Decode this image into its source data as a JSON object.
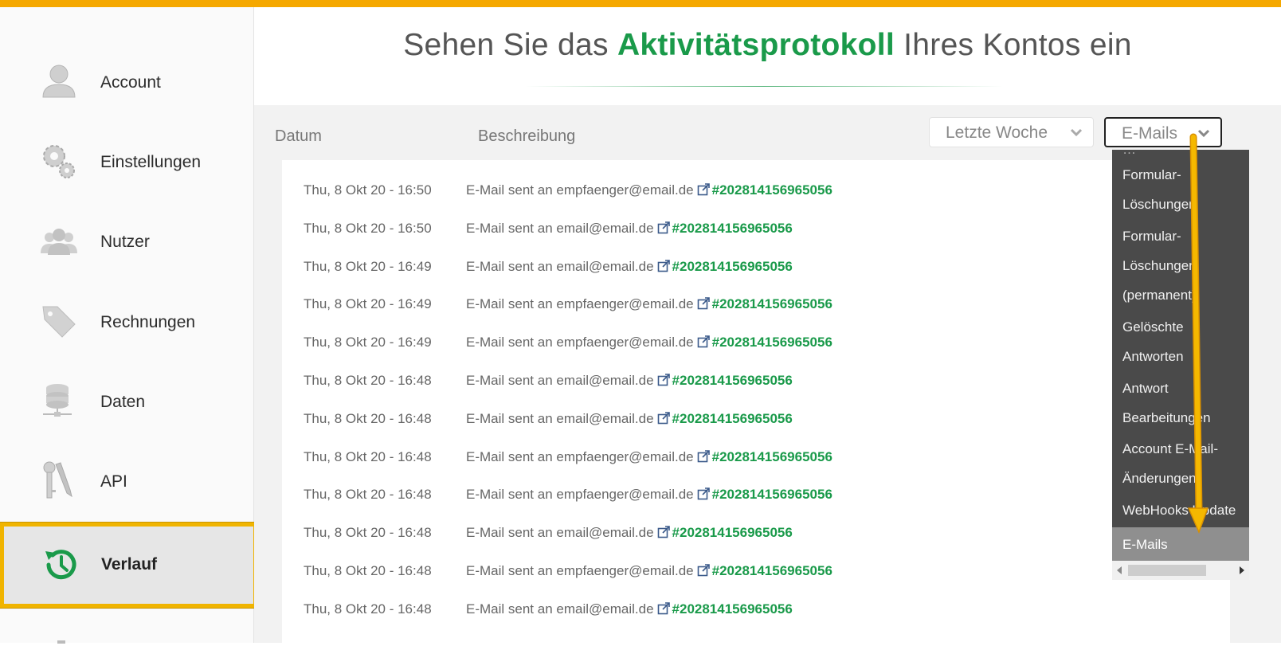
{
  "header": {
    "title_part1": "Sehen Sie das ",
    "title_highlight": "Aktivitätsprotokoll",
    "title_part2": " Ihres Kontos ein"
  },
  "sidebar": {
    "items": [
      {
        "label": "Account",
        "icon": "user-icon"
      },
      {
        "label": "Einstellungen",
        "icon": "gears-icon"
      },
      {
        "label": "Nutzer",
        "icon": "users-icon"
      },
      {
        "label": "Rechnungen",
        "icon": "tag-icon"
      },
      {
        "label": "Daten",
        "icon": "database-icon"
      },
      {
        "label": "API",
        "icon": "keys-icon"
      },
      {
        "label": "Verlauf",
        "icon": "history-icon",
        "active": true
      }
    ]
  },
  "table": {
    "col_date": "Datum",
    "col_desc": "Beschreibung",
    "filter_time": "Letzte Woche",
    "filter_type": "E-Mails",
    "rows": [
      {
        "date": "Thu, 8 Okt 20 - 16:50",
        "text": "E-Mail sent an empfaenger@email.de",
        "link": "#202814156965056"
      },
      {
        "date": "Thu, 8 Okt 20 - 16:50",
        "text": "E-Mail sent an email@email.de",
        "link": "#202814156965056"
      },
      {
        "date": "Thu, 8 Okt 20 - 16:49",
        "text": "E-Mail sent an email@email.de",
        "link": "#202814156965056"
      },
      {
        "date": "Thu, 8 Okt 20 - 16:49",
        "text": "E-Mail sent an empfaenger@email.de",
        "link": "#202814156965056"
      },
      {
        "date": "Thu, 8 Okt 20 - 16:49",
        "text": "E-Mail sent an empfaenger@email.de",
        "link": "#202814156965056"
      },
      {
        "date": "Thu, 8 Okt 20 - 16:48",
        "text": "E-Mail sent an email@email.de",
        "link": "#202814156965056"
      },
      {
        "date": "Thu, 8 Okt 20 - 16:48",
        "text": "E-Mail sent an email@email.de",
        "link": "#202814156965056"
      },
      {
        "date": "Thu, 8 Okt 20 - 16:48",
        "text": "E-Mail sent an empfaenger@email.de",
        "link": "#202814156965056"
      },
      {
        "date": "Thu, 8 Okt 20 - 16:48",
        "text": "E-Mail sent an empfaenger@email.de",
        "link": "#202814156965056"
      },
      {
        "date": "Thu, 8 Okt 20 - 16:48",
        "text": "E-Mail sent an email@email.de",
        "link": "#202814156965056"
      },
      {
        "date": "Thu, 8 Okt 20 - 16:48",
        "text": "E-Mail sent an empfaenger@email.de",
        "link": "#202814156965056"
      },
      {
        "date": "Thu, 8 Okt 20 - 16:48",
        "text": "E-Mail sent an email@email.de",
        "link": "#202814156965056"
      }
    ]
  },
  "dropdown": {
    "items": [
      "Formular-",
      "Löschungen",
      "Formular-",
      "Löschungen",
      "(permanent)",
      "Gelöschte",
      "Antworten",
      "Antwort",
      "Bearbeitungen",
      "Account E-Mail-",
      "Änderungen",
      "WebHooks Update"
    ],
    "selected": "E-Mails"
  },
  "colors": {
    "accent_green": "#1a9a4a",
    "top_bar": "#f5a800",
    "highlight_box": "#f0b400",
    "dropdown_bg": "#4a4a4a"
  }
}
